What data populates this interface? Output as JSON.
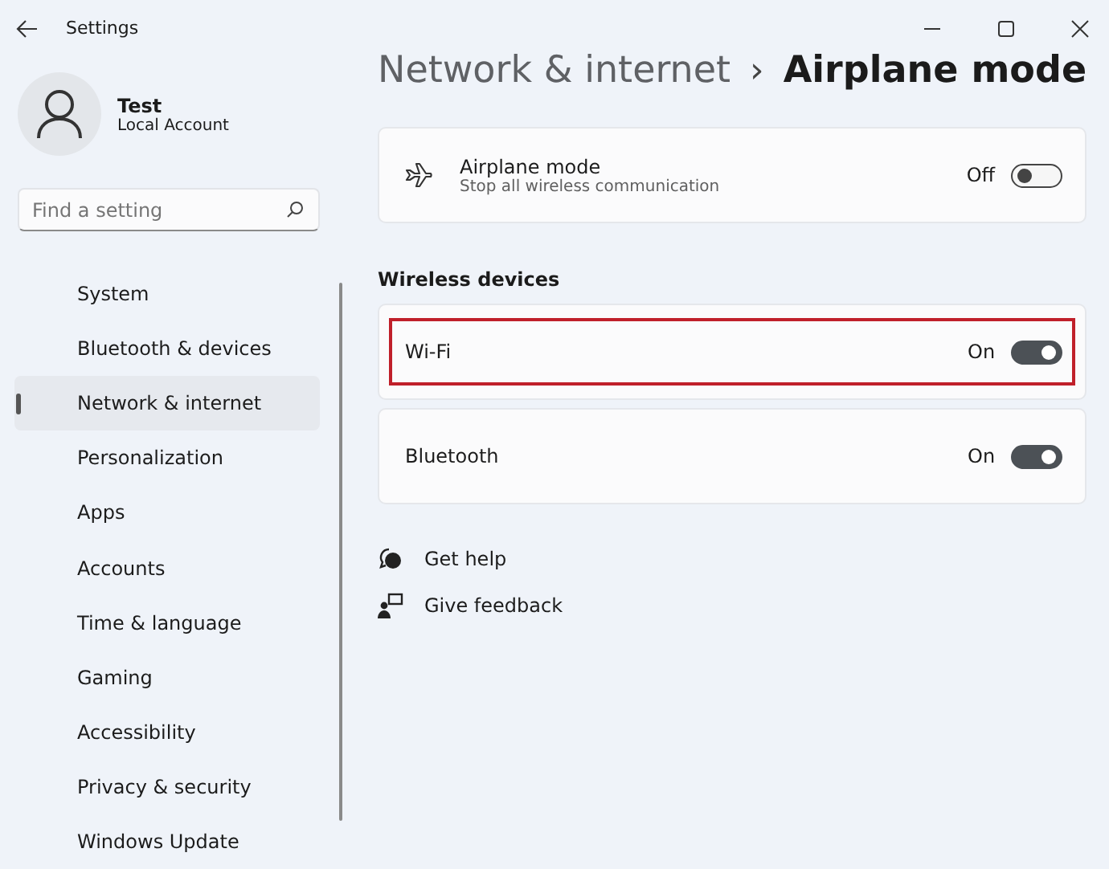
{
  "window": {
    "title": "Settings"
  },
  "account": {
    "name": "Test",
    "type": "Local Account"
  },
  "search": {
    "placeholder": "Find a setting"
  },
  "sidebar": {
    "items": [
      {
        "label": "System",
        "selected": false
      },
      {
        "label": "Bluetooth & devices",
        "selected": false
      },
      {
        "label": "Network & internet",
        "selected": true
      },
      {
        "label": "Personalization",
        "selected": false
      },
      {
        "label": "Apps",
        "selected": false
      },
      {
        "label": "Accounts",
        "selected": false
      },
      {
        "label": "Time & language",
        "selected": false
      },
      {
        "label": "Gaming",
        "selected": false
      },
      {
        "label": "Accessibility",
        "selected": false
      },
      {
        "label": "Privacy & security",
        "selected": false
      },
      {
        "label": "Windows Update",
        "selected": false
      }
    ]
  },
  "breadcrumb": {
    "parent": "Network & internet",
    "separator": "›",
    "current": "Airplane mode"
  },
  "airplane_mode": {
    "title": "Airplane mode",
    "description": "Stop all wireless communication",
    "state_label": "Off",
    "on": false
  },
  "wireless_devices": {
    "heading": "Wireless devices",
    "items": [
      {
        "label": "Wi-Fi",
        "state_label": "On",
        "on": true,
        "highlighted": true
      },
      {
        "label": "Bluetooth",
        "state_label": "On",
        "on": true,
        "highlighted": false
      }
    ]
  },
  "links": [
    {
      "kind": "help",
      "label": "Get help"
    },
    {
      "kind": "feedback",
      "label": "Give feedback"
    }
  ]
}
